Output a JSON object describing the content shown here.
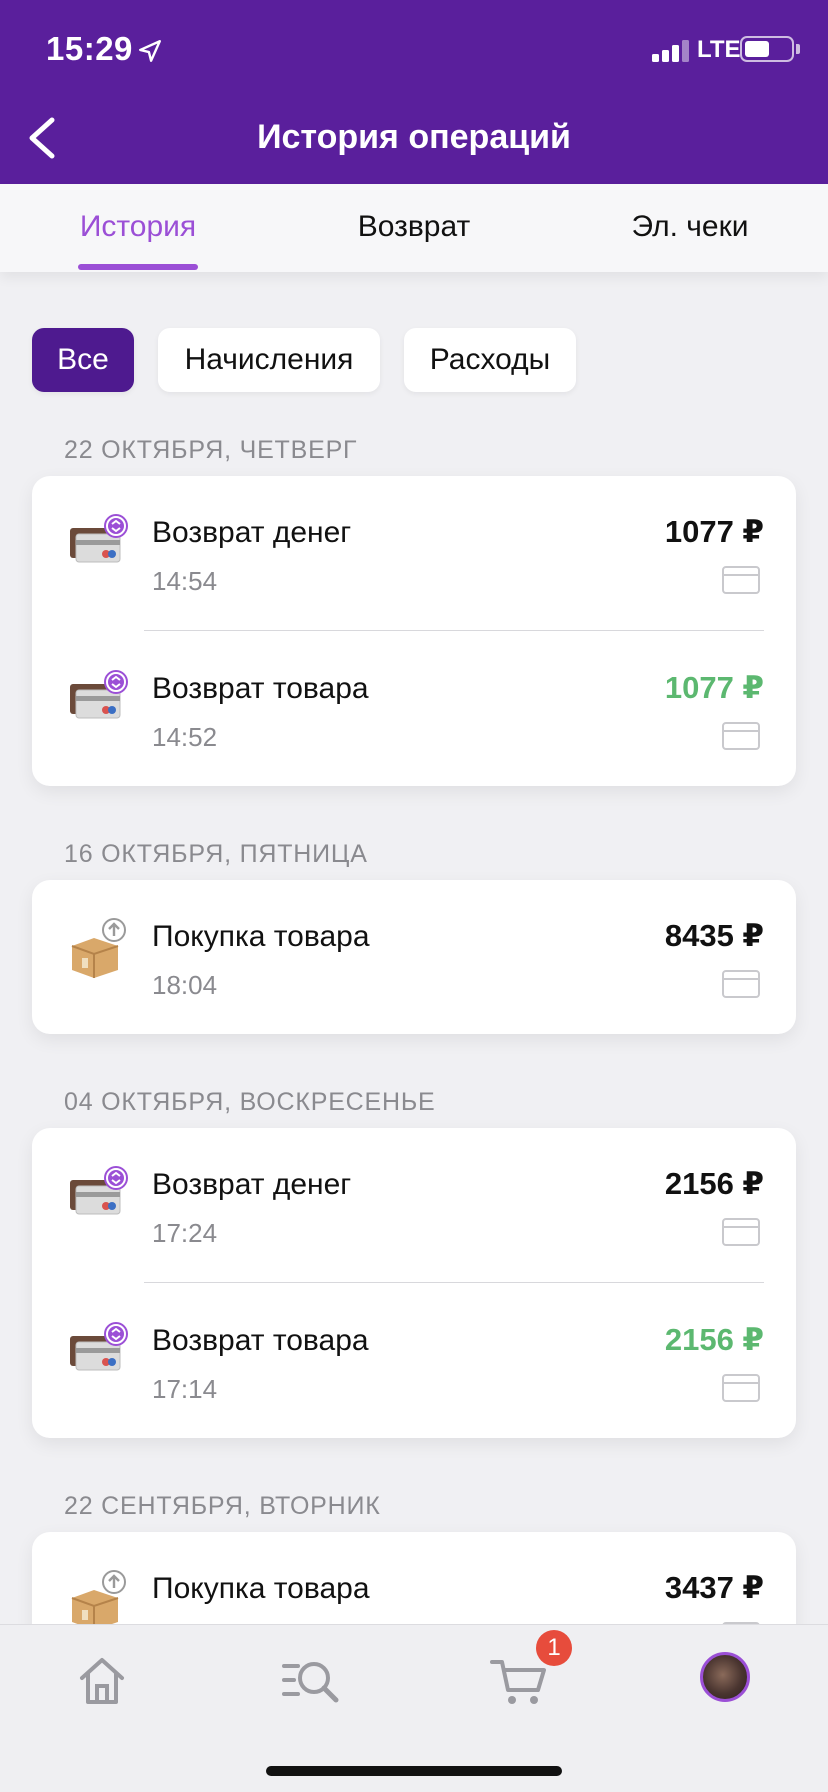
{
  "status_bar": {
    "time": "15:29",
    "network": "LTE",
    "battery_level": 0.55
  },
  "header": {
    "title": "История операций"
  },
  "tabs": [
    {
      "label": "История",
      "active": true
    },
    {
      "label": "Возврат",
      "active": false
    },
    {
      "label": "Эл. чеки",
      "active": false
    }
  ],
  "filters": [
    {
      "label": "Все",
      "active": true
    },
    {
      "label": "Начисления",
      "active": false
    },
    {
      "label": "Расходы",
      "active": false
    }
  ],
  "sections": [
    {
      "date": "22 ОКТЯБРЯ, ЧЕТВЕРГ",
      "items": [
        {
          "type": "refund-money",
          "title": "Возврат денег",
          "time": "14:54",
          "amount": "1077 ₽",
          "amount_color": "#111111"
        },
        {
          "type": "refund-goods",
          "title": "Возврат товара",
          "time": "14:52",
          "amount": "1077 ₽",
          "amount_color": "#5cb870"
        }
      ]
    },
    {
      "date": "16 ОКТЯБРЯ, ПЯТНИЦА",
      "items": [
        {
          "type": "purchase",
          "title": "Покупка товара",
          "time": "18:04",
          "amount": "8435 ₽",
          "amount_color": "#111111"
        }
      ]
    },
    {
      "date": "04 ОКТЯБРЯ, ВОСКРЕСЕНЬЕ",
      "items": [
        {
          "type": "refund-money",
          "title": "Возврат денег",
          "time": "17:24",
          "amount": "2156 ₽",
          "amount_color": "#111111"
        },
        {
          "type": "refund-goods",
          "title": "Возврат товара",
          "time": "17:14",
          "amount": "2156 ₽",
          "amount_color": "#5cb870"
        }
      ]
    },
    {
      "date": "22 СЕНТЯБРЯ, ВТОРНИК",
      "items": [
        {
          "type": "purchase",
          "title": "Покупка товара",
          "time": "",
          "amount": "3437 ₽",
          "amount_color": "#111111"
        }
      ]
    }
  ],
  "bottom_nav": {
    "items": [
      "home-icon",
      "catalog-search-icon",
      "cart-icon",
      "profile-avatar"
    ],
    "cart_badge": "1"
  },
  "colors": {
    "brand": "#5a1f9c",
    "accent": "#9b4fd6",
    "income": "#5cb870",
    "badge": "#e74c3c"
  }
}
